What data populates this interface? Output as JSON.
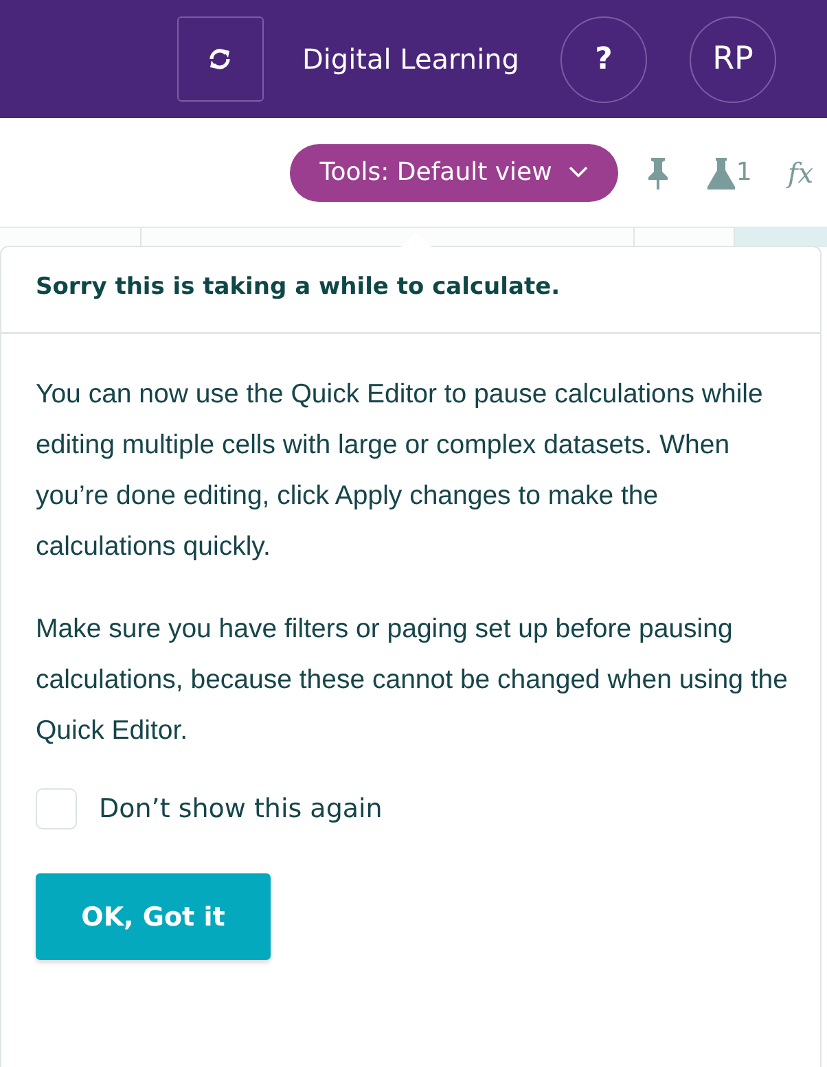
{
  "header": {
    "title": "Digital Learning",
    "help": "?",
    "avatar": "RP"
  },
  "toolbar": {
    "tools_button": "Tools: Default view",
    "flask_count": "1",
    "formula": "fx"
  },
  "popover": {
    "title": "Sorry this is taking a while to calculate.",
    "paragraphs": [
      "You can now use the Quick Editor to pause calculations while editing multiple cells with large or complex datasets. When you’re done editing, click Apply changes to make the calculations quickly.",
      "Make sure you have filters or paging set up before pausing calculations, because these cannot be changed when using the Quick Editor."
    ],
    "checkbox": {
      "label": "Don’t show this again",
      "checked": false
    },
    "button": "OK, Got it"
  }
}
